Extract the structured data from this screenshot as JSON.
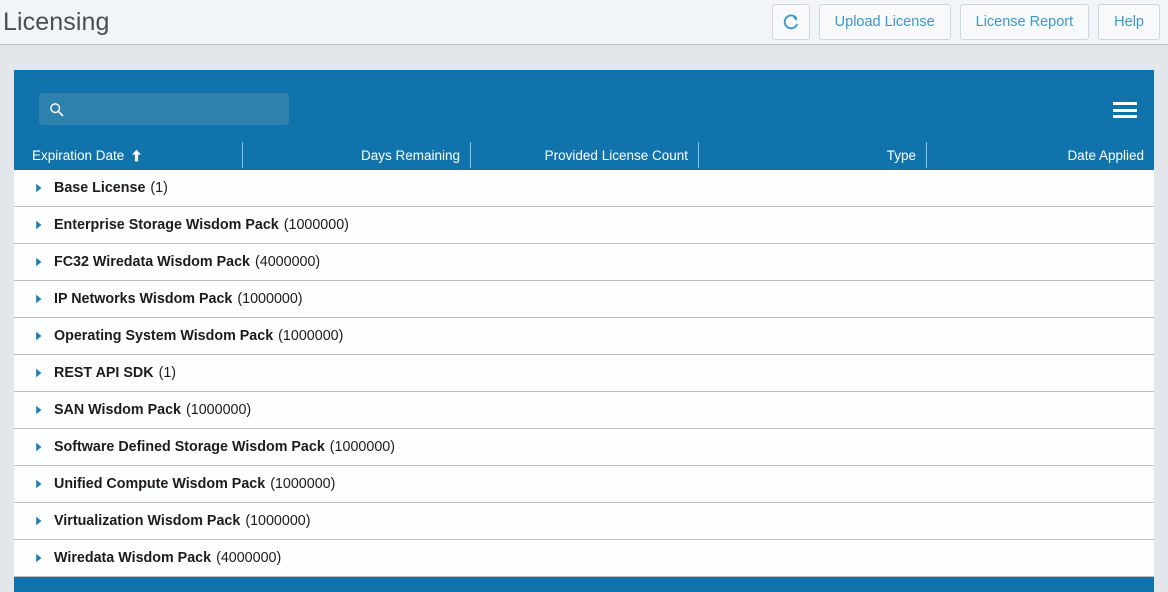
{
  "header": {
    "title": "Licensing",
    "actions": [
      {
        "name": "refresh-button",
        "label": "",
        "icon": "refresh-icon"
      },
      {
        "name": "upload-license-button",
        "label": "Upload License",
        "icon": ""
      },
      {
        "name": "license-report-button",
        "label": "License Report",
        "icon": ""
      },
      {
        "name": "help-button",
        "label": "Help",
        "icon": ""
      }
    ]
  },
  "toolbar": {
    "search": {
      "value": "",
      "placeholder": "",
      "icon": "search-icon"
    },
    "menu": {
      "icon": "hamburger-menu-icon",
      "label": ""
    }
  },
  "table": {
    "columns": [
      {
        "label": "Expiration Date",
        "sort": "ascending",
        "sort_icon": "arrow-up-icon"
      },
      {
        "label": "Days Remaining",
        "sort": "none",
        "sort_icon": ""
      },
      {
        "label": "Provided License Count",
        "sort": "none",
        "sort_icon": ""
      },
      {
        "label": "Type",
        "sort": "none",
        "sort_icon": ""
      },
      {
        "label": "Date Applied",
        "sort": "none",
        "sort_icon": ""
      }
    ],
    "rows": [
      {
        "label": "Base License",
        "count": "(1)",
        "expanded": false,
        "caret": "caret-right-icon"
      },
      {
        "label": "Enterprise Storage Wisdom Pack",
        "count": "(1000000)",
        "expanded": false,
        "caret": "caret-right-icon"
      },
      {
        "label": "FC32 Wiredata Wisdom Pack",
        "count": "(4000000)",
        "expanded": false,
        "caret": "caret-right-icon"
      },
      {
        "label": "IP Networks Wisdom Pack",
        "count": "(1000000)",
        "expanded": false,
        "caret": "caret-right-icon"
      },
      {
        "label": "Operating System Wisdom Pack",
        "count": "(1000000)",
        "expanded": false,
        "caret": "caret-right-icon"
      },
      {
        "label": "REST API SDK",
        "count": "(1)",
        "expanded": false,
        "caret": "caret-right-icon"
      },
      {
        "label": "SAN Wisdom Pack",
        "count": "(1000000)",
        "expanded": false,
        "caret": "caret-right-icon"
      },
      {
        "label": "Software Defined Storage Wisdom Pack",
        "count": "(1000000)",
        "expanded": false,
        "caret": "caret-right-icon"
      },
      {
        "label": "Unified Compute Wisdom Pack",
        "count": "(1000000)",
        "expanded": false,
        "caret": "caret-right-icon"
      },
      {
        "label": "Virtualization Wisdom Pack",
        "count": "(1000000)",
        "expanded": false,
        "caret": "caret-right-icon"
      },
      {
        "label": "Wiredata Wisdom Pack",
        "count": "(4000000)",
        "expanded": false,
        "caret": "caret-right-icon"
      }
    ]
  },
  "colors": {
    "accent_blue": "#1173ab",
    "search_blue": "#2e80ad",
    "link_blue": "#3e96c9",
    "page_bg": "#e3e6ea",
    "header_bg": "#f2f5f8",
    "row_bg": "#fdfefe",
    "row_border": "#b9bfc5",
    "title_text": "#4a4f54"
  }
}
